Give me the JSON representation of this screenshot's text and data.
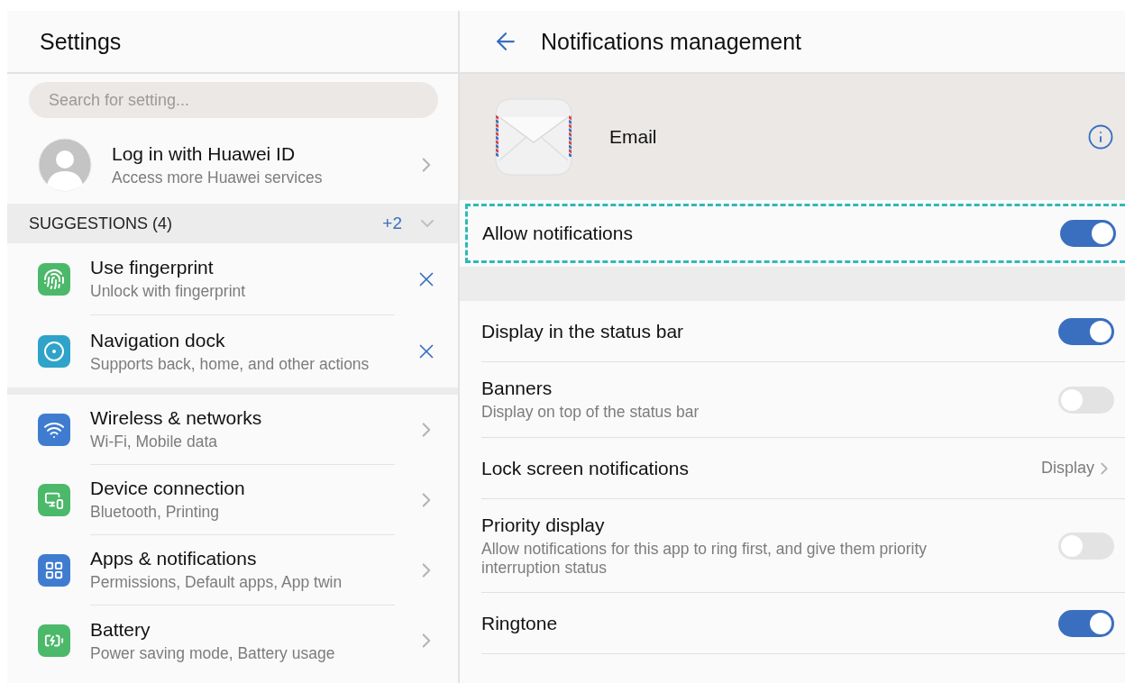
{
  "settings_panel": {
    "title": "Settings",
    "search": {
      "placeholder": "Search for setting..."
    },
    "account": {
      "title": "Log in with Huawei ID",
      "subtitle": "Access more Huawei services"
    },
    "suggestions": {
      "header": "SUGGESTIONS (4)",
      "more": "+2",
      "items": [
        {
          "kind": "fingerprint",
          "color": "#4cb86a",
          "title": "Use fingerprint",
          "subtitle": "Unlock with fingerprint"
        },
        {
          "kind": "dock",
          "color": "#2fa3c9",
          "title": "Navigation dock",
          "subtitle": "Supports back, home, and other actions"
        }
      ]
    },
    "categories": [
      {
        "kind": "wifi",
        "color": "#3f7cd0",
        "title": "Wireless & networks",
        "subtitle": "Wi-Fi, Mobile data"
      },
      {
        "kind": "device",
        "color": "#4cb86a",
        "title": "Device connection",
        "subtitle": "Bluetooth, Printing"
      },
      {
        "kind": "apps",
        "color": "#3f7cd0",
        "title": "Apps & notifications",
        "subtitle": "Permissions, Default apps, App twin"
      },
      {
        "kind": "battery",
        "color": "#4cb86a",
        "title": "Battery",
        "subtitle": "Power saving mode, Battery usage"
      }
    ]
  },
  "detail_panel": {
    "title": "Notifications management",
    "app": {
      "name": "Email"
    },
    "allow": {
      "label": "Allow notifications",
      "on": true
    },
    "settings": [
      {
        "kind": "toggle",
        "label": "Display in the status bar",
        "on": true
      },
      {
        "kind": "toggle",
        "label": "Banners",
        "subtitle": "Display on top of the status bar",
        "on": false
      },
      {
        "kind": "link",
        "label": "Lock screen notifications",
        "value": "Display"
      },
      {
        "kind": "toggle",
        "label": "Priority display",
        "subtitle": "Allow notifications for this app to ring first, and give them priority interruption status",
        "on": false
      },
      {
        "kind": "toggle",
        "label": "Ringtone",
        "on": true
      }
    ]
  }
}
